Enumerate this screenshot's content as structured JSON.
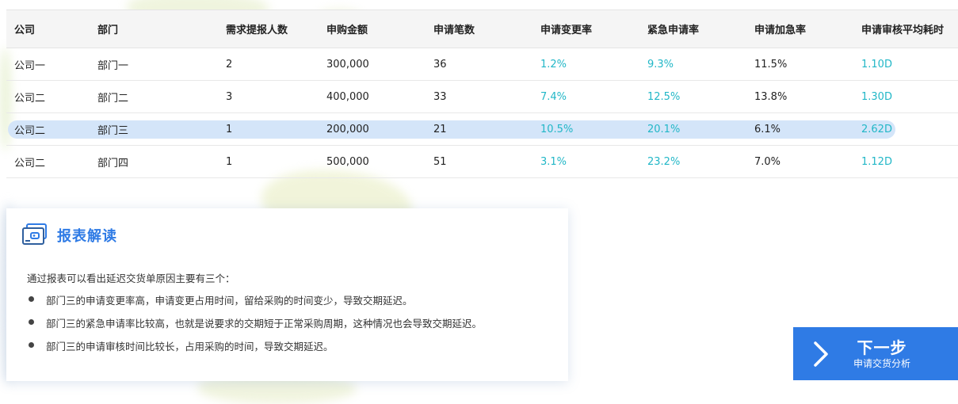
{
  "table": {
    "headers": [
      "公司",
      "部门",
      "需求提报人数",
      "申购金额",
      "申请笔数",
      "申请变更率",
      "紧急申请率",
      "申请加急率",
      "申请审核平均耗时"
    ],
    "rows": [
      [
        "公司一",
        "部门一",
        "2",
        "300,000",
        "36",
        "1.2%",
        "9.3%",
        "11.5%",
        "1.10D"
      ],
      [
        "公司二",
        "部门二",
        "3",
        "400,000",
        "33",
        "7.4%",
        "12.5%",
        "13.8%",
        "1.30D"
      ],
      [
        "公司二",
        "部门三",
        "1",
        "200,000",
        "21",
        "10.5%",
        "20.1%",
        "6.1%",
        "2.62D"
      ],
      [
        "公司二",
        "部门四",
        "1",
        "500,000",
        "51",
        "3.1%",
        "23.2%",
        "7.0%",
        "1.12D"
      ]
    ],
    "selected_row": 2,
    "highlight_color": "#22b7c7",
    "selected_bg": "#d4e5f9"
  },
  "report": {
    "icon": "report-wallet-icon",
    "title": "报表解读",
    "intro": "通过报表可以看出延迟交货单原因主要有三个：",
    "bullets": [
      "部门三的申请变更率高，申请变更占用时间，留给采购的时间变少，导致交期延迟。",
      "部门三的紧急申请率比较高，也就是说要求的交期短于正常采购周期，这种情况也会导致交期延迟。",
      "部门三的申请审核时间比较长，占用采购的时间，导致交期延迟。"
    ]
  },
  "next_button": {
    "icon": "chevron-right-icon",
    "label": "下一步",
    "sublabel": "申请交货分析",
    "color": "#2f7be5"
  }
}
